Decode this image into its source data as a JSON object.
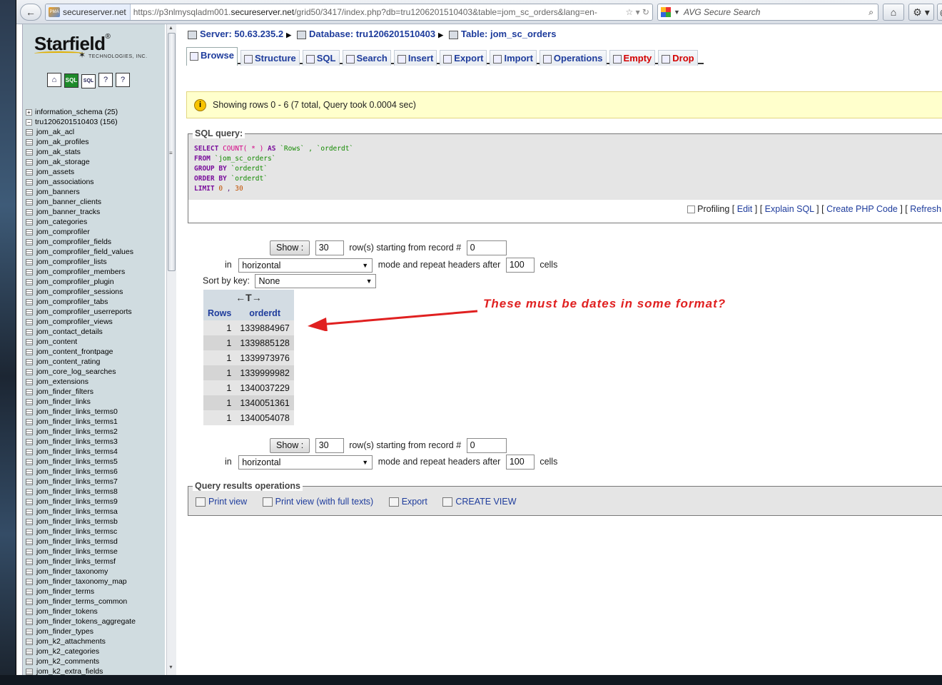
{
  "browser": {
    "back_glyph": "←",
    "site_identity": "secureserver.net",
    "site_icon_text": "PMA",
    "url_prefix": "https://p3nlmysqladm001.",
    "url_domain": "secureserver.net",
    "url_rest": "/grid50/3417/index.php?db=tru1206201510403&table=jom_sc_orders&lang=en-",
    "url_icons": "☆ ▾ ↻",
    "search_placeholder": "AVG Secure Search",
    "search_dd": "▼",
    "search_glyph": "⌕",
    "home_glyph": "⌂",
    "tools_glyph": "⚙ ▾",
    "eye_glyph": "◉"
  },
  "sidebar": {
    "logo_text": "Starfield",
    "logo_reg": "®",
    "logo_sub": "TECHNOLOGIES, INC.",
    "logo_star": "✶",
    "icons": [
      {
        "glyph": "⌂"
      },
      {
        "glyph": "SQL"
      },
      {
        "glyph": "SQL"
      },
      {
        "glyph": "?"
      },
      {
        "glyph": "?"
      }
    ],
    "databases": [
      {
        "sign": "+",
        "label": "information_schema (25)"
      },
      {
        "sign": "−",
        "label": "tru1206201510403 (156)"
      }
    ],
    "tables": [
      "jom_ak_acl",
      "jom_ak_profiles",
      "jom_ak_stats",
      "jom_ak_storage",
      "jom_assets",
      "jom_associations",
      "jom_banners",
      "jom_banner_clients",
      "jom_banner_tracks",
      "jom_categories",
      "jom_comprofiler",
      "jom_comprofiler_fields",
      "jom_comprofiler_field_values",
      "jom_comprofiler_lists",
      "jom_comprofiler_members",
      "jom_comprofiler_plugin",
      "jom_comprofiler_sessions",
      "jom_comprofiler_tabs",
      "jom_comprofiler_userreports",
      "jom_comprofiler_views",
      "jom_contact_details",
      "jom_content",
      "jom_content_frontpage",
      "jom_content_rating",
      "jom_core_log_searches",
      "jom_extensions",
      "jom_finder_filters",
      "jom_finder_links",
      "jom_finder_links_terms0",
      "jom_finder_links_terms1",
      "jom_finder_links_terms2",
      "jom_finder_links_terms3",
      "jom_finder_links_terms4",
      "jom_finder_links_terms5",
      "jom_finder_links_terms6",
      "jom_finder_links_terms7",
      "jom_finder_links_terms8",
      "jom_finder_links_terms9",
      "jom_finder_links_termsa",
      "jom_finder_links_termsb",
      "jom_finder_links_termsc",
      "jom_finder_links_termsd",
      "jom_finder_links_termse",
      "jom_finder_links_termsf",
      "jom_finder_taxonomy",
      "jom_finder_taxonomy_map",
      "jom_finder_terms",
      "jom_finder_terms_common",
      "jom_finder_tokens",
      "jom_finder_tokens_aggregate",
      "jom_finder_types",
      "jom_k2_attachments",
      "jom_k2_categories",
      "jom_k2_comments",
      "jom_k2_extra_fields"
    ],
    "scroll_grip": "≡",
    "scroll_up": "▲",
    "scroll_down": "▼"
  },
  "breadcrumb": {
    "server": "Server: 50.63.235.2",
    "database": "Database: tru1206201510403",
    "table": "Table: jom_sc_orders",
    "sep": "▶"
  },
  "tabs": [
    {
      "label": "Browse",
      "active": true,
      "danger": false
    },
    {
      "label": "Structure",
      "active": false,
      "danger": false
    },
    {
      "label": "SQL",
      "active": false,
      "danger": false
    },
    {
      "label": "Search",
      "active": false,
      "danger": false
    },
    {
      "label": "Insert",
      "active": false,
      "danger": false
    },
    {
      "label": "Export",
      "active": false,
      "danger": false
    },
    {
      "label": "Import",
      "active": false,
      "danger": false
    },
    {
      "label": "Operations",
      "active": false,
      "danger": false
    },
    {
      "label": "Empty",
      "active": false,
      "danger": true
    },
    {
      "label": "Drop",
      "active": false,
      "danger": true
    }
  ],
  "notice": {
    "icon": "i",
    "text": "Showing rows 0 - 6 (7 total, Query took 0.0004 sec)"
  },
  "sql": {
    "legend": "SQL query:",
    "line1": {
      "kw": "SELECT",
      "fn": "COUNT(",
      "star": " * ",
      "close": ")",
      "as": " AS ",
      "alias": "`Rows`",
      "rest": " , `orderdt`"
    },
    "line2": {
      "kw": "FROM",
      "tbl": " `jom_sc_orders`"
    },
    "line3": {
      "kw": "GROUP BY",
      "col": " `orderdt`"
    },
    "line4": {
      "kw": "ORDER BY",
      "col": " `orderdt`"
    },
    "line5": {
      "kw": "LIMIT",
      "n1": " 0",
      "sep": " , ",
      "n2": "30"
    },
    "profiling": "Profiling",
    "links": [
      "Edit",
      "Explain SQL",
      "Create PHP Code",
      "Refresh"
    ]
  },
  "nav": {
    "show_btn": "Show :",
    "rows_value": "30",
    "rows_text": "row(s) starting from record #",
    "start_value": "0",
    "in_text": "in",
    "mode_value": "horizontal",
    "mode_text": "mode and repeat headers after",
    "repeat_value": "100",
    "cells_text": "cells",
    "sort_text": "Sort by key:",
    "sort_value": "None",
    "dd": "▼"
  },
  "results": {
    "fulltext_glyph": "←T→",
    "columns": [
      "Rows",
      "orderdt"
    ],
    "rows": [
      [
        "1",
        "1339884967"
      ],
      [
        "1",
        "1339885128"
      ],
      [
        "1",
        "1339973976"
      ],
      [
        "1",
        "1339999982"
      ],
      [
        "1",
        "1340037229"
      ],
      [
        "1",
        "1340051361"
      ],
      [
        "1",
        "1340054078"
      ]
    ]
  },
  "annotation": "These must be dates in some format?",
  "ops": {
    "legend": "Query results operations",
    "links": [
      "Print view",
      "Print view (with full texts)",
      "Export",
      "CREATE VIEW"
    ]
  }
}
